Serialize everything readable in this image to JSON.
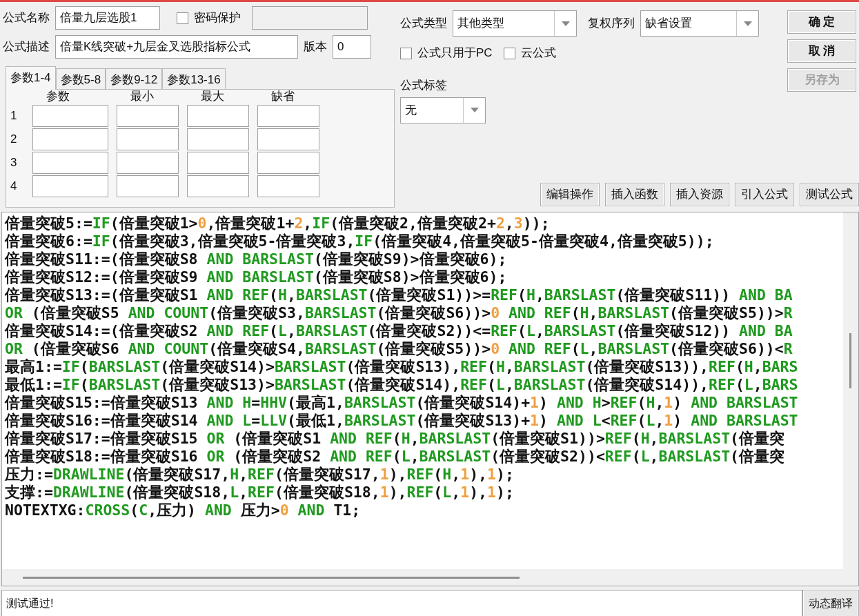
{
  "form": {
    "name_label": "公式名称",
    "name_value": "倍量九层选股1",
    "password_protect": {
      "label": "密码保护",
      "checked": false
    },
    "description_label": "公式描述",
    "description_value": "倍量K线突破+九层金叉选股指标公式",
    "version_label": "版本",
    "version_value": "0"
  },
  "param_tabs": [
    {
      "label": "参数1-4",
      "selected": true
    },
    {
      "label": "参数5-8",
      "selected": false
    },
    {
      "label": "参数9-12",
      "selected": false
    },
    {
      "label": "参数13-16",
      "selected": false
    }
  ],
  "param_table": {
    "columns": [
      "参数",
      "最小",
      "最大",
      "缺省"
    ],
    "rows": [
      "1",
      "2",
      "3",
      "4"
    ]
  },
  "formula_type": {
    "label": "公式类型",
    "value": "其他类型"
  },
  "adjust_sequence": {
    "label": "复权序列",
    "value": "缺省设置"
  },
  "options": [
    {
      "label": "公式只用于PC",
      "checked": false
    },
    {
      "label": "云公式",
      "checked": false
    }
  ],
  "tag": {
    "label": "公式标签",
    "value": "无"
  },
  "dialog_buttons": [
    {
      "label": "确 定",
      "disabled": false
    },
    {
      "label": "取 消",
      "disabled": false
    },
    {
      "label": "另存为",
      "disabled": true
    }
  ],
  "tool_buttons": [
    "编辑操作",
    "插入函数",
    "插入资源",
    "引入公式",
    "测试公式"
  ],
  "code_lines": [
    [
      {
        "kind": "text",
        "text": "倍量突破5:="
      },
      {
        "kind": "keyword",
        "text": "IF"
      },
      {
        "kind": "text",
        "text": "(倍量突破1>"
      },
      {
        "kind": "number",
        "text": "0"
      },
      {
        "kind": "text",
        "text": ",倍量突破1+"
      },
      {
        "kind": "number",
        "text": "2"
      },
      {
        "kind": "text",
        "text": ","
      },
      {
        "kind": "keyword",
        "text": "IF"
      },
      {
        "kind": "text",
        "text": "(倍量突破2,倍量突破2+"
      },
      {
        "kind": "number",
        "text": "2"
      },
      {
        "kind": "text",
        "text": ","
      },
      {
        "kind": "number",
        "text": "3"
      },
      {
        "kind": "text",
        "text": "));"
      }
    ],
    [
      {
        "kind": "text",
        "text": "倍量突破6:="
      },
      {
        "kind": "keyword",
        "text": "IF"
      },
      {
        "kind": "text",
        "text": "(倍量突破3,倍量突破5-倍量突破3,"
      },
      {
        "kind": "keyword",
        "text": "IF"
      },
      {
        "kind": "text",
        "text": "(倍量突破4,倍量突破5-倍量突破4,倍量突破5));"
      }
    ],
    [
      {
        "kind": "text",
        "text": "倍量突破S11:=(倍量突破S8 "
      },
      {
        "kind": "keyword",
        "text": "AND BARSLAST"
      },
      {
        "kind": "text",
        "text": "(倍量突破S9)>倍量突破6);"
      }
    ],
    [
      {
        "kind": "text",
        "text": "倍量突破S12:=(倍量突破S9 "
      },
      {
        "kind": "keyword",
        "text": "AND BARSLAST"
      },
      {
        "kind": "text",
        "text": "(倍量突破S8)>倍量突破6);"
      }
    ],
    [
      {
        "kind": "text",
        "text": "倍量突破S13:=(倍量突破S1 "
      },
      {
        "kind": "keyword",
        "text": "AND REF"
      },
      {
        "kind": "text",
        "text": "("
      },
      {
        "kind": "keyword",
        "text": "H"
      },
      {
        "kind": "text",
        "text": ","
      },
      {
        "kind": "keyword",
        "text": "BARSLAST"
      },
      {
        "kind": "text",
        "text": "(倍量突破S1))>="
      },
      {
        "kind": "keyword",
        "text": "REF"
      },
      {
        "kind": "text",
        "text": "("
      },
      {
        "kind": "keyword",
        "text": "H"
      },
      {
        "kind": "text",
        "text": ","
      },
      {
        "kind": "keyword",
        "text": "BARSLAST"
      },
      {
        "kind": "text",
        "text": "(倍量突破S11)) "
      },
      {
        "kind": "keyword",
        "text": "AND BA"
      }
    ],
    [
      {
        "kind": "keyword",
        "text": "OR"
      },
      {
        "kind": "text",
        "text": " (倍量突破S5 "
      },
      {
        "kind": "keyword",
        "text": "AND COUNT"
      },
      {
        "kind": "text",
        "text": "(倍量突破S3,"
      },
      {
        "kind": "keyword",
        "text": "BARSLAST"
      },
      {
        "kind": "text",
        "text": "(倍量突破S6))>"
      },
      {
        "kind": "number",
        "text": "0"
      },
      {
        "kind": "keyword",
        "text": " AND REF"
      },
      {
        "kind": "text",
        "text": "("
      },
      {
        "kind": "keyword",
        "text": "H"
      },
      {
        "kind": "text",
        "text": ","
      },
      {
        "kind": "keyword",
        "text": "BARSLAST"
      },
      {
        "kind": "text",
        "text": "(倍量突破S5))>"
      },
      {
        "kind": "keyword",
        "text": "R"
      }
    ],
    [
      {
        "kind": "text",
        "text": "倍量突破S14:=(倍量突破S2 "
      },
      {
        "kind": "keyword",
        "text": "AND REF"
      },
      {
        "kind": "text",
        "text": "("
      },
      {
        "kind": "keyword",
        "text": "L"
      },
      {
        "kind": "text",
        "text": ","
      },
      {
        "kind": "keyword",
        "text": "BARSLAST"
      },
      {
        "kind": "text",
        "text": "(倍量突破S2))<="
      },
      {
        "kind": "keyword",
        "text": "REF"
      },
      {
        "kind": "text",
        "text": "("
      },
      {
        "kind": "keyword",
        "text": "L"
      },
      {
        "kind": "text",
        "text": ","
      },
      {
        "kind": "keyword",
        "text": "BARSLAST"
      },
      {
        "kind": "text",
        "text": "(倍量突破S12)) "
      },
      {
        "kind": "keyword",
        "text": "AND BA"
      }
    ],
    [
      {
        "kind": "keyword",
        "text": "OR"
      },
      {
        "kind": "text",
        "text": " (倍量突破S6 "
      },
      {
        "kind": "keyword",
        "text": "AND COUNT"
      },
      {
        "kind": "text",
        "text": "(倍量突破S4,"
      },
      {
        "kind": "keyword",
        "text": "BARSLAST"
      },
      {
        "kind": "text",
        "text": "(倍量突破S5))>"
      },
      {
        "kind": "number",
        "text": "0"
      },
      {
        "kind": "keyword",
        "text": " AND REF"
      },
      {
        "kind": "text",
        "text": "("
      },
      {
        "kind": "keyword",
        "text": "L"
      },
      {
        "kind": "text",
        "text": ","
      },
      {
        "kind": "keyword",
        "text": "BARSLAST"
      },
      {
        "kind": "text",
        "text": "(倍量突破S6))<"
      },
      {
        "kind": "keyword",
        "text": "R"
      }
    ],
    [
      {
        "kind": "text",
        "text": "最高1:="
      },
      {
        "kind": "keyword",
        "text": "IF"
      },
      {
        "kind": "text",
        "text": "("
      },
      {
        "kind": "keyword",
        "text": "BARSLAST"
      },
      {
        "kind": "text",
        "text": "(倍量突破S14)>"
      },
      {
        "kind": "keyword",
        "text": "BARSLAST"
      },
      {
        "kind": "text",
        "text": "(倍量突破S13),"
      },
      {
        "kind": "keyword",
        "text": "REF"
      },
      {
        "kind": "text",
        "text": "("
      },
      {
        "kind": "keyword",
        "text": "H"
      },
      {
        "kind": "text",
        "text": ","
      },
      {
        "kind": "keyword",
        "text": "BARSLAST"
      },
      {
        "kind": "text",
        "text": "(倍量突破S13)),"
      },
      {
        "kind": "keyword",
        "text": "REF"
      },
      {
        "kind": "text",
        "text": "("
      },
      {
        "kind": "keyword",
        "text": "H"
      },
      {
        "kind": "text",
        "text": ","
      },
      {
        "kind": "keyword",
        "text": "BARS"
      }
    ],
    [
      {
        "kind": "text",
        "text": "最低1:="
      },
      {
        "kind": "keyword",
        "text": "IF"
      },
      {
        "kind": "text",
        "text": "("
      },
      {
        "kind": "keyword",
        "text": "BARSLAST"
      },
      {
        "kind": "text",
        "text": "(倍量突破S13)>"
      },
      {
        "kind": "keyword",
        "text": "BARSLAST"
      },
      {
        "kind": "text",
        "text": "(倍量突破S14),"
      },
      {
        "kind": "keyword",
        "text": "REF"
      },
      {
        "kind": "text",
        "text": "("
      },
      {
        "kind": "keyword",
        "text": "L"
      },
      {
        "kind": "text",
        "text": ","
      },
      {
        "kind": "keyword",
        "text": "BARSLAST"
      },
      {
        "kind": "text",
        "text": "(倍量突破S14)),"
      },
      {
        "kind": "keyword",
        "text": "REF"
      },
      {
        "kind": "text",
        "text": "("
      },
      {
        "kind": "keyword",
        "text": "L"
      },
      {
        "kind": "text",
        "text": ","
      },
      {
        "kind": "keyword",
        "text": "BARS"
      }
    ],
    [
      {
        "kind": "text",
        "text": "倍量突破S15:=倍量突破S13 "
      },
      {
        "kind": "keyword",
        "text": "AND H"
      },
      {
        "kind": "text",
        "text": "="
      },
      {
        "kind": "keyword",
        "text": "HHV"
      },
      {
        "kind": "text",
        "text": "(最高1,"
      },
      {
        "kind": "keyword",
        "text": "BARSLAST"
      },
      {
        "kind": "text",
        "text": "(倍量突破S14)+"
      },
      {
        "kind": "number",
        "text": "1"
      },
      {
        "kind": "text",
        "text": ") "
      },
      {
        "kind": "keyword",
        "text": "AND H"
      },
      {
        "kind": "text",
        "text": ">"
      },
      {
        "kind": "keyword",
        "text": "REF"
      },
      {
        "kind": "text",
        "text": "("
      },
      {
        "kind": "keyword",
        "text": "H"
      },
      {
        "kind": "text",
        "text": ","
      },
      {
        "kind": "number",
        "text": "1"
      },
      {
        "kind": "text",
        "text": ") "
      },
      {
        "kind": "keyword",
        "text": "AND BARSLAST"
      }
    ],
    [
      {
        "kind": "text",
        "text": "倍量突破S16:=倍量突破S14 "
      },
      {
        "kind": "keyword",
        "text": "AND L"
      },
      {
        "kind": "text",
        "text": "="
      },
      {
        "kind": "keyword",
        "text": "LLV"
      },
      {
        "kind": "text",
        "text": "(最低1,"
      },
      {
        "kind": "keyword",
        "text": "BARSLAST"
      },
      {
        "kind": "text",
        "text": "(倍量突破S13)+"
      },
      {
        "kind": "number",
        "text": "1"
      },
      {
        "kind": "text",
        "text": ") "
      },
      {
        "kind": "keyword",
        "text": "AND L"
      },
      {
        "kind": "text",
        "text": "<"
      },
      {
        "kind": "keyword",
        "text": "REF"
      },
      {
        "kind": "text",
        "text": "("
      },
      {
        "kind": "keyword",
        "text": "L"
      },
      {
        "kind": "text",
        "text": ","
      },
      {
        "kind": "number",
        "text": "1"
      },
      {
        "kind": "text",
        "text": ") "
      },
      {
        "kind": "keyword",
        "text": "AND BARSLAST"
      }
    ],
    [
      {
        "kind": "text",
        "text": "倍量突破S17:=倍量突破S15 "
      },
      {
        "kind": "keyword",
        "text": "OR"
      },
      {
        "kind": "text",
        "text": " (倍量突破S1 "
      },
      {
        "kind": "keyword",
        "text": "AND REF"
      },
      {
        "kind": "text",
        "text": "("
      },
      {
        "kind": "keyword",
        "text": "H"
      },
      {
        "kind": "text",
        "text": ","
      },
      {
        "kind": "keyword",
        "text": "BARSLAST"
      },
      {
        "kind": "text",
        "text": "(倍量突破S1))>"
      },
      {
        "kind": "keyword",
        "text": "REF"
      },
      {
        "kind": "text",
        "text": "("
      },
      {
        "kind": "keyword",
        "text": "H"
      },
      {
        "kind": "text",
        "text": ","
      },
      {
        "kind": "keyword",
        "text": "BARSLAST"
      },
      {
        "kind": "text",
        "text": "(倍量突"
      }
    ],
    [
      {
        "kind": "text",
        "text": "倍量突破S18:=倍量突破S16 "
      },
      {
        "kind": "keyword",
        "text": "OR"
      },
      {
        "kind": "text",
        "text": " (倍量突破S2 "
      },
      {
        "kind": "keyword",
        "text": "AND REF"
      },
      {
        "kind": "text",
        "text": "("
      },
      {
        "kind": "keyword",
        "text": "L"
      },
      {
        "kind": "text",
        "text": ","
      },
      {
        "kind": "keyword",
        "text": "BARSLAST"
      },
      {
        "kind": "text",
        "text": "(倍量突破S2))<"
      },
      {
        "kind": "keyword",
        "text": "REF"
      },
      {
        "kind": "text",
        "text": "("
      },
      {
        "kind": "keyword",
        "text": "L"
      },
      {
        "kind": "text",
        "text": ","
      },
      {
        "kind": "keyword",
        "text": "BARSLAST"
      },
      {
        "kind": "text",
        "text": "(倍量突"
      }
    ],
    [
      {
        "kind": "text",
        "text": "压力:="
      },
      {
        "kind": "keyword",
        "text": "DRAWLINE"
      },
      {
        "kind": "text",
        "text": "(倍量突破S17,"
      },
      {
        "kind": "keyword",
        "text": "H"
      },
      {
        "kind": "text",
        "text": ","
      },
      {
        "kind": "keyword",
        "text": "REF"
      },
      {
        "kind": "text",
        "text": "(倍量突破S17,"
      },
      {
        "kind": "number",
        "text": "1"
      },
      {
        "kind": "text",
        "text": "),"
      },
      {
        "kind": "keyword",
        "text": "REF"
      },
      {
        "kind": "text",
        "text": "("
      },
      {
        "kind": "keyword",
        "text": "H"
      },
      {
        "kind": "text",
        "text": ","
      },
      {
        "kind": "number",
        "text": "1"
      },
      {
        "kind": "text",
        "text": "),"
      },
      {
        "kind": "number",
        "text": "1"
      },
      {
        "kind": "text",
        "text": ");"
      }
    ],
    [
      {
        "kind": "text",
        "text": "支撑:="
      },
      {
        "kind": "keyword",
        "text": "DRAWLINE"
      },
      {
        "kind": "text",
        "text": "(倍量突破S18,"
      },
      {
        "kind": "keyword",
        "text": "L"
      },
      {
        "kind": "text",
        "text": ","
      },
      {
        "kind": "keyword",
        "text": "REF"
      },
      {
        "kind": "text",
        "text": "(倍量突破S18,"
      },
      {
        "kind": "number",
        "text": "1"
      },
      {
        "kind": "text",
        "text": "),"
      },
      {
        "kind": "keyword",
        "text": "REF"
      },
      {
        "kind": "text",
        "text": "("
      },
      {
        "kind": "keyword",
        "text": "L"
      },
      {
        "kind": "text",
        "text": ","
      },
      {
        "kind": "number",
        "text": "1"
      },
      {
        "kind": "text",
        "text": "),"
      },
      {
        "kind": "number",
        "text": "1"
      },
      {
        "kind": "text",
        "text": ");"
      }
    ],
    [
      {
        "kind": "text",
        "text": "NOTEXTXG:"
      },
      {
        "kind": "keyword",
        "text": "CROSS"
      },
      {
        "kind": "text",
        "text": "("
      },
      {
        "kind": "keyword",
        "text": "C"
      },
      {
        "kind": "text",
        "text": ",压力) "
      },
      {
        "kind": "keyword",
        "text": "AND"
      },
      {
        "kind": "text",
        "text": " 压力>"
      },
      {
        "kind": "number",
        "text": "0"
      },
      {
        "kind": "keyword",
        "text": " AND"
      },
      {
        "kind": "text",
        "text": " T1;"
      }
    ]
  ],
  "status": {
    "message": "测试通过!",
    "button": "动态翻译"
  }
}
